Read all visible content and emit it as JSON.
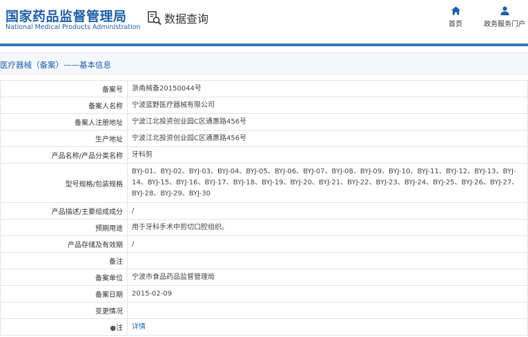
{
  "header": {
    "logo_cn": "国家药品监督管理局",
    "logo_en": "National Medical Products Administration",
    "query_title": "数据查询",
    "nav": [
      {
        "label": "首页",
        "icon": "home-icon"
      },
      {
        "label": "政务服务门户",
        "icon": "user-icon"
      }
    ]
  },
  "colors": {
    "brand": "#1f5fa8",
    "accent_line": "#3b78b8",
    "link": "#2a6bb3"
  },
  "section": {
    "title": "医疗器械（备案）——基本信息"
  },
  "rows": [
    {
      "label": "备案号",
      "value": "浙甬械备20150044号"
    },
    {
      "label": "备案人名称",
      "value": "宁波蓝野医疗器械有限公司"
    },
    {
      "label": "备案人注册地址",
      "value": "宁波江北投资创业园C区通惠路456号"
    },
    {
      "label": "生产地址",
      "value": "宁波江北投资创业园C区通惠路456号"
    },
    {
      "label": "产品名称/产品分类名称",
      "value": "牙科剪"
    },
    {
      "label": "型号规格/包装规格",
      "value": "BYJ-01、BYJ-02、BYJ-03、BYJ-04、BYJ-05、BYJ-06、BYJ-07、BYJ-08、BYJ-09、BYJ-10、BYJ-11、BYJ-12、BYJ-13、BYJ-14、BYJ-15、BYJ-16、BYJ-17、BYJ-18、BYJ-19、BYJ-20、BYJ-21、BYJ-22、BYJ-23、BYJ-24、BYJ-25、BYJ-26、BYJ-27、BYJ-28、BYJ-29、BYJ-30"
    },
    {
      "label": "产品描述/主要组成成分",
      "value": "/"
    },
    {
      "label": "预期用途",
      "value": "用于牙科手术中剪切口腔组织。"
    },
    {
      "label": "产品存储及有效期",
      "value": "/"
    },
    {
      "label": "备注",
      "value": ""
    },
    {
      "label": "备案单位",
      "value": "宁波市食品药品监督管理局"
    },
    {
      "label": "备案日期",
      "value": "2015-02-09"
    },
    {
      "label": "变更情况",
      "value": ""
    }
  ],
  "note": {
    "label": "注",
    "link": "详情"
  }
}
